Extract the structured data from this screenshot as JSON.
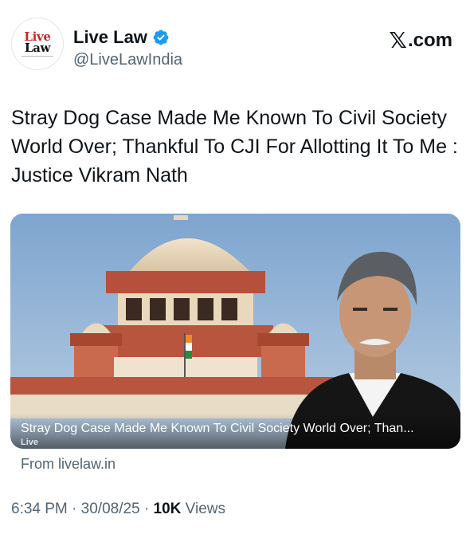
{
  "author": {
    "avatar_text_line1": "Live",
    "avatar_text_line2": "Law",
    "name": "Live Law",
    "handle": "@LiveLawIndia",
    "verified": true
  },
  "branding": {
    "x_glyph": "𝕏",
    "x_domain": ".com"
  },
  "tweet": {
    "text": "Stray Dog Case Made Me Known To Civil Society World Over; Thankful To CJI For Allotting It To Me : Justice Vikram Nath"
  },
  "link_card": {
    "caption": "Stray Dog Case Made Me Known To Civil Society World Over; Than...",
    "badge": "Live",
    "source": "From livelaw.in"
  },
  "meta": {
    "time": "6:34 PM",
    "date": "30/08/25",
    "separator": " · ",
    "views_count": "10K",
    "views_label": " Views"
  },
  "colors": {
    "verified_badge": "#1d9bf0",
    "secondary_text": "#536471",
    "brand_red": "#c62828"
  }
}
